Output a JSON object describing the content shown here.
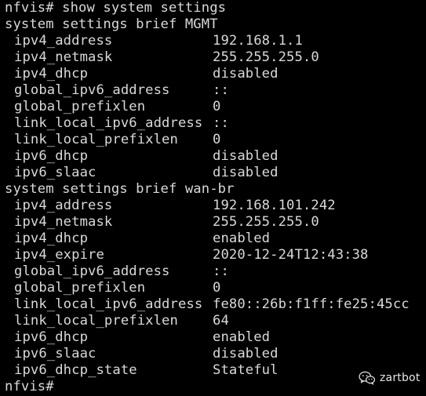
{
  "terminal": {
    "prompt": "nfvis#",
    "command": "show system settings",
    "sections": [
      {
        "header": "system settings brief MGMT",
        "rows": [
          {
            "key": "ipv4_address",
            "value": "192.168.1.1"
          },
          {
            "key": "ipv4_netmask",
            "value": "255.255.255.0"
          },
          {
            "key": "ipv4_dhcp",
            "value": "disabled"
          },
          {
            "key": "global_ipv6_address",
            "value": "::"
          },
          {
            "key": "global_prefixlen",
            "value": "0"
          },
          {
            "key": "link_local_ipv6_address",
            "value": "::"
          },
          {
            "key": "link_local_prefixlen",
            "value": "0"
          },
          {
            "key": "ipv6_dhcp",
            "value": "disabled"
          },
          {
            "key": "ipv6_slaac",
            "value": "disabled"
          }
        ]
      },
      {
        "header": "system settings brief wan-br",
        "rows": [
          {
            "key": "ipv4_address",
            "value": "192.168.101.242"
          },
          {
            "key": "ipv4_netmask",
            "value": "255.255.255.0"
          },
          {
            "key": "ipv4_dhcp",
            "value": "enabled"
          },
          {
            "key": "ipv4_expire",
            "value": "2020-12-24T12:43:38"
          },
          {
            "key": "global_ipv6_address",
            "value": "::"
          },
          {
            "key": "global_prefixlen",
            "value": "0"
          },
          {
            "key": "link_local_ipv6_address",
            "value": "fe80::26b:f1ff:fe25:45cc"
          },
          {
            "key": "link_local_prefixlen",
            "value": "64"
          },
          {
            "key": "ipv6_dhcp",
            "value": "enabled"
          },
          {
            "key": "ipv6_slaac",
            "value": "disabled"
          },
          {
            "key": "ipv6_dhcp_state",
            "value": "Stateful"
          }
        ]
      }
    ],
    "final_prompt": "nfvis#"
  },
  "watermark": {
    "brand": "zartbot",
    "logo_icon": "wechat-icon"
  },
  "colors": {
    "background": "#000000",
    "text": "#d9d9d9"
  }
}
